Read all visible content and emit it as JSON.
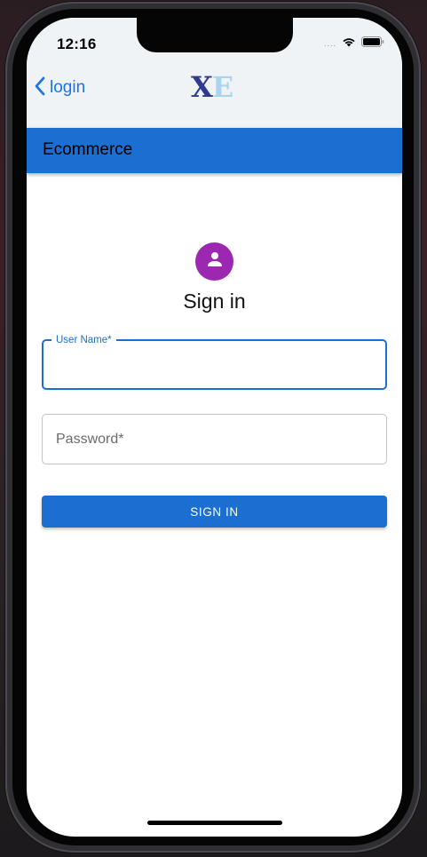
{
  "status_bar": {
    "time": "12:16",
    "signal_dots": "....",
    "icons": [
      "wifi-icon",
      "battery-icon"
    ]
  },
  "nav": {
    "back_label": "login",
    "back_icon": "chevron-left-icon",
    "logo_x": "X",
    "logo_e": "E"
  },
  "appbar": {
    "title": "Ecommerce"
  },
  "signin": {
    "avatar_icon": "person-icon",
    "title": "Sign in",
    "username_label": "User Name*",
    "username_value": "",
    "password_placeholder": "Password*",
    "password_value": "",
    "button_label": "SIGN IN"
  },
  "colors": {
    "primary": "#1b6fd0",
    "avatar": "#9c27b0",
    "logo_x": "#2e3b8f",
    "logo_e": "#a9d4ef",
    "nav_background": "#f0f3f5",
    "link": "#1a73e8"
  }
}
